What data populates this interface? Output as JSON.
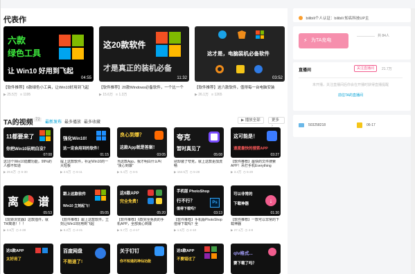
{
  "representative": {
    "title": "代表作",
    "cards": [
      {
        "thumb": [
          "六款",
          "绿色工具",
          "让 Win10 好用到飞起"
        ],
        "duration": "04:55",
        "title": "【软件推荐】6款绿色小工具，让Win10好用到飞起",
        "views": "25.5万",
        "danmaku": "1195"
      },
      {
        "thumb": [
          "这20款软件",
          "才是真正的装机必备"
        ],
        "duration": "11:32",
        "title": "【软件推荐】20款Windows必备软件，一个比一个",
        "views": "15.6万",
        "danmaku": "1.3万"
      },
      {
        "thumb": [
          "这才是，电脑装机必备软件"
        ],
        "duration": "03:52",
        "title": "【软件推荐】这六款软件，值得每一台电脑安装",
        "views": "26.1万",
        "danmaku": "1265"
      }
    ]
  },
  "videos": {
    "title": "TA的视频",
    "count": "72",
    "tabs": [
      "最新发布",
      "最多播放",
      "最多收藏"
    ],
    "play_all": "播放全部",
    "more": "更多",
    "rows": [
      [
        {
          "thumb": [
            "11都要来了",
            "你把Win10玩明白没？"
          ],
          "duration": "07:08",
          "title": "这10个Win10隐藏功能，99%的人都不知道",
          "views": "29.6万",
          "date": "6-30"
        },
        {
          "thumb": [
            "强化Win10!",
            "这一定会用到的软件！"
          ],
          "duration": "01:15",
          "title": "提上这款软件，补足Win10的一大短板",
          "views": "2.5万",
          "date": "6-11"
        },
        {
          "thumb": [
            "良心到爆？",
            "这款App就是答案！"
          ],
          "duration": "03:05",
          "title": "当这款App，我才明白什么叫 \"良心到爆\"",
          "views": "6.4万",
          "date": "6-5"
        },
        {
          "thumb": [
            "夸克",
            "暂时真见了"
          ],
          "duration": "05:08",
          "title": "别却装了夸克，就上这款更加流畅",
          "views": "164.5万",
          "date": "5-28"
        },
        {
          "thumb": [
            "这可能是！",
            "速度最快的搜索APP"
          ],
          "duration": "03:27",
          "title": "【软件推荐】最快的文件搜索APP！吊打手机Everything",
          "views": "3.4万",
          "date": "5-20"
        }
      ],
      [
        {
          "thumb": [
            "离",
            "谱"
          ],
          "duration": "05:53",
          "title": "【玩转浏览器】这款插件，就TM离谱！！！",
          "views": "3.6万",
          "date": "4-28"
        },
        {
          "thumb": [
            "跟上这款软件",
            "Win10 立刻起飞！"
          ],
          "duration": "05:05",
          "title": "【软件推荐】跟上这款软件，立刻让Win10好用到飞起",
          "views": "5.2万",
          "date": "4-21"
        },
        {
          "thumb": [
            "这6款APP",
            "完全免费！"
          ],
          "duration": "05:20",
          "title": "【软件推荐】6款完全免费的手机APP，全部良心到爆",
          "views": "5.7万",
          "date": "4-17"
        },
        {
          "thumb": [
            "手机版 PhotoShop",
            "行不行？",
            "值得下载吗？"
          ],
          "duration": "03:13",
          "title": "【软件推荐】手机版PhotoShop值得下载吗？全",
          "views": "1.5万",
          "date": "4-10"
        },
        {
          "thumb": [
            "可以非常的",
            "下载神器"
          ],
          "duration": "01:30",
          "title": "【软件推荐】一款可以非常的下载神器",
          "views": "27.1万",
          "date": "4-8"
        }
      ],
      [
        {
          "thumb": [
            "这6款APP",
            "太好用了"
          ],
          "duration": "",
          "title": "",
          "views": "",
          "date": ""
        },
        {
          "thumb": [
            "百度网盘",
            "不限速了!"
          ],
          "duration": "",
          "title": "",
          "views": "",
          "date": ""
        },
        {
          "thumb": [
            "关于钉钉",
            "你不知道的神仙功能"
          ],
          "duration": "",
          "title": "",
          "views": "",
          "date": ""
        },
        {
          "thumb": [
            "这6款APP",
            "不要错过了"
          ],
          "duration": "",
          "title": "",
          "views": "",
          "date": ""
        },
        {
          "thumb": [
            "qlv格式...",
            "要下载了吗？"
          ],
          "duration": "",
          "title": "",
          "views": "",
          "date": ""
        }
      ]
    ]
  },
  "sidebar": {
    "cert": "bilibili个人认证：bilibili 知名科技UP主",
    "charge_button": "为TA充电",
    "charge_count": "共 84人",
    "announcement": {
      "title": "直播间",
      "follow": "关注直播间",
      "count": "21.7万",
      "text": "未开播，关注直播间后你会在开播时获得直播提醒",
      "link": "前往TA的直播间"
    },
    "uid": "503258218",
    "birthday": "06-17"
  },
  "colors": {
    "accent": "#00a1d6",
    "pink": "#f25d8e",
    "bg": "#f4f5f7"
  }
}
